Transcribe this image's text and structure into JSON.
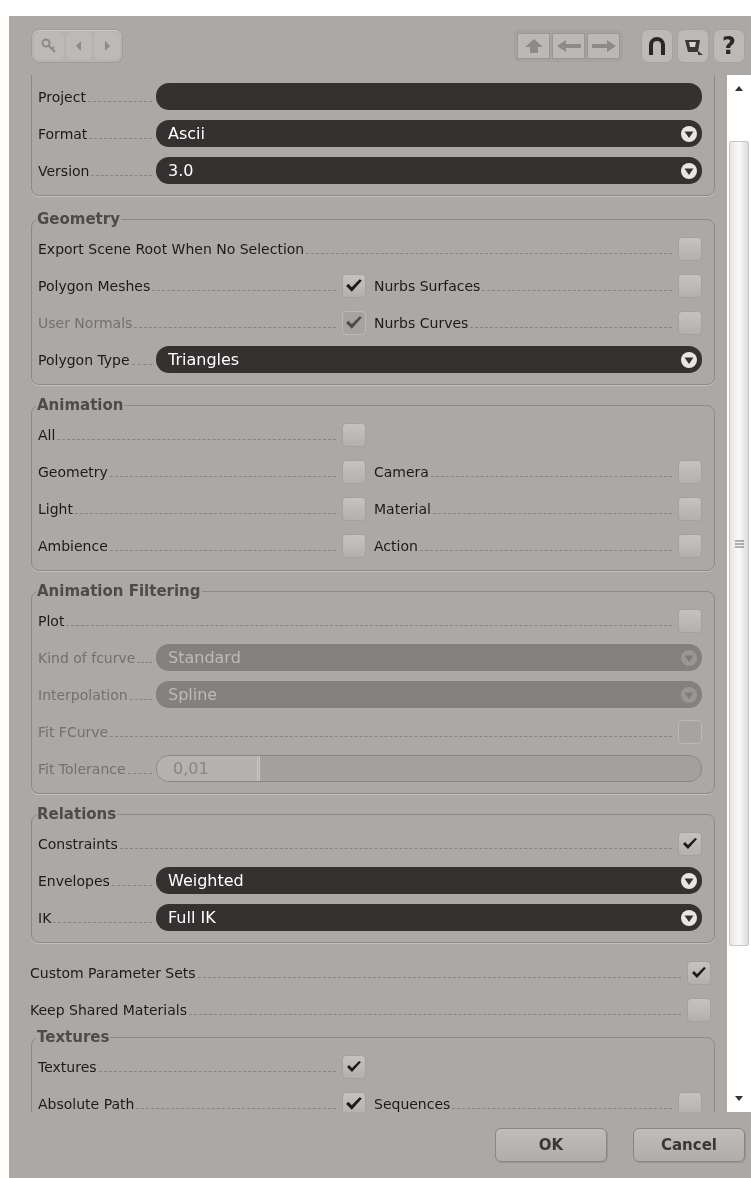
{
  "toolbar": {
    "help": "?"
  },
  "groups": [
    {
      "kind": "panel",
      "rows": [
        {
          "kind": "text",
          "label": "Project",
          "value": null
        },
        {
          "kind": "dropdown",
          "label": "Format",
          "value": "Ascii",
          "disabled": false
        },
        {
          "kind": "dropdown",
          "label": "Version",
          "value": "3.0",
          "disabled": false
        }
      ]
    },
    {
      "title": "Geometry",
      "rows": [
        {
          "kind": "check",
          "label": "Export Scene Root When No Selection",
          "checked": false,
          "disabled": false
        },
        {
          "kind": "pair",
          "left": {
            "label": "Polygon Meshes",
            "checked": true,
            "disabled": false
          },
          "right": {
            "label": "Nurbs Surfaces",
            "checked": false,
            "disabled": false
          }
        },
        {
          "kind": "pair",
          "left": {
            "label": "User Normals",
            "checked": true,
            "disabled": true
          },
          "right": {
            "label": "Nurbs Curves",
            "checked": false,
            "disabled": false
          }
        },
        {
          "kind": "dropdown",
          "label": "Polygon Type",
          "value": "Triangles",
          "disabled": false
        }
      ]
    },
    {
      "title": "Animation",
      "rows": [
        {
          "kind": "half",
          "label": "All",
          "checked": false,
          "disabled": false
        },
        {
          "kind": "pair",
          "left": {
            "label": "Geometry",
            "checked": false,
            "disabled": false
          },
          "right": {
            "label": "Camera",
            "checked": false,
            "disabled": false
          }
        },
        {
          "kind": "pair",
          "left": {
            "label": "Light",
            "checked": false,
            "disabled": false
          },
          "right": {
            "label": "Material",
            "checked": false,
            "disabled": false
          }
        },
        {
          "kind": "pair",
          "left": {
            "label": "Ambience",
            "checked": false,
            "disabled": false
          },
          "right": {
            "label": "Action",
            "checked": false,
            "disabled": false
          }
        }
      ]
    },
    {
      "title": "Animation Filtering",
      "rows": [
        {
          "kind": "check",
          "label": "Plot",
          "checked": false,
          "disabled": false
        },
        {
          "kind": "dropdown",
          "label": "Kind of fcurve",
          "value": "Standard",
          "disabled": true
        },
        {
          "kind": "dropdown",
          "label": "Interpolation",
          "value": "Spline",
          "disabled": true
        },
        {
          "kind": "check",
          "label": "Fit FCurve",
          "checked": false,
          "disabled": true
        },
        {
          "kind": "slider",
          "label": "Fit Tolerance",
          "value": "0,01",
          "level": 0.19,
          "disabled": true
        }
      ]
    },
    {
      "title": "Relations",
      "rows": [
        {
          "kind": "check",
          "label": "Constraints",
          "checked": true,
          "disabled": false
        },
        {
          "kind": "dropdown",
          "label": "Envelopes",
          "value": "Weighted",
          "disabled": false
        },
        {
          "kind": "dropdown",
          "label": "IK",
          "value": "Full IK",
          "disabled": false
        }
      ]
    },
    {
      "kind": "plain",
      "rows": [
        {
          "kind": "check",
          "label": "Custom Parameter Sets",
          "checked": true,
          "disabled": false
        },
        {
          "kind": "check",
          "label": "Keep Shared Materials",
          "checked": false,
          "disabled": false
        }
      ]
    },
    {
      "title": "Textures",
      "rows": [
        {
          "kind": "half",
          "label": "Textures",
          "checked": true,
          "disabled": false
        },
        {
          "kind": "pair",
          "left": {
            "label": "Absolute Path",
            "checked": true,
            "disabled": false
          },
          "right": {
            "label": "Sequences",
            "checked": false,
            "disabled": false
          }
        }
      ]
    }
  ],
  "buttons": [
    {
      "label": "OK"
    },
    {
      "label": "Cancel"
    }
  ]
}
